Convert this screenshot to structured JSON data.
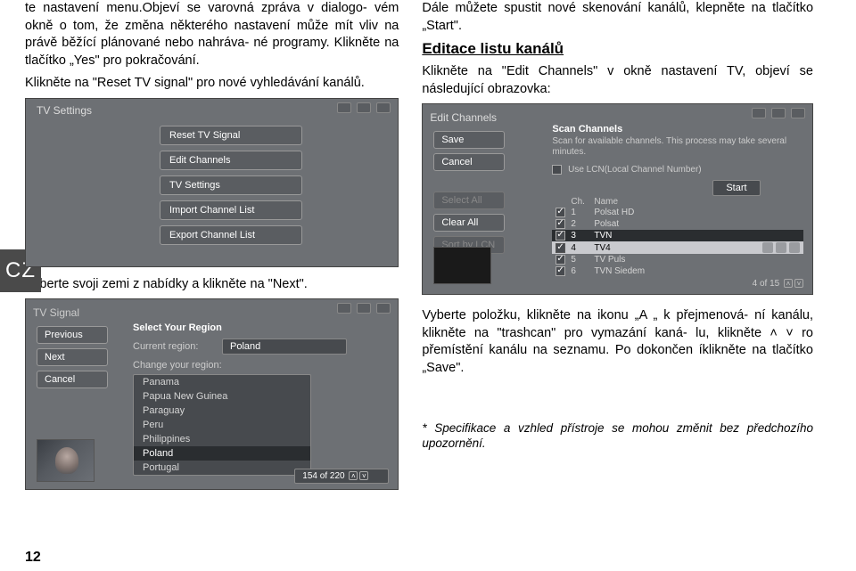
{
  "left": {
    "p1": "te nastavení menu.Objeví se varovná zpráva v dialogo-",
    "p2": "vém okně o tom, že změna některého nastavení může",
    "p3": "mít vliv na právě běžící plánované nebo nahráva-",
    "p4": "né programy. Klikněte na tlačítko „Yes\" pro pokračování.",
    "p5": "Klikněte na \"Reset TV signal\" pro nové vyhledávání kanálů.",
    "caption1": "Vyberte svoji zemi z nabídky a klikněte na  \"Next\".",
    "tvset": {
      "title": "TV Settings",
      "btns": [
        "Reset TV Signal",
        "Edit Channels",
        "TV Settings",
        "Import Channel List",
        "Export Channel List"
      ]
    },
    "tvsig": {
      "title": "TV Signal",
      "leftbtns": [
        "Previous",
        "Next",
        "Cancel"
      ],
      "regionLabel": "Select Your Region",
      "currentRegion": "Current region:",
      "currentVal": "Poland",
      "changeRegion": "Change your region:",
      "countries": [
        "Panama",
        "Papua New Guinea",
        "Paraguay",
        "Peru",
        "Philippines",
        "Poland",
        "Portugal"
      ],
      "counter": "154 of 220"
    }
  },
  "right": {
    "p1": "Dále můžete spustit nové skenování kanálů, klepněte",
    "p2": "na tlačítko „Start\".",
    "head": "Editace listu kanálů",
    "p3": "Klikněte na \"Edit Channels\" v okně nastavení TV, objeví",
    "p4": "se následující obrazovka:",
    "edit": {
      "title": "Edit Channels",
      "btns1": [
        "Save",
        "Cancel"
      ],
      "btns2": [
        "Select All",
        "Clear All",
        "Sort by LCN"
      ],
      "scanTitle": "Scan Channels",
      "scanDesc": "Scan for available channels. This process may take several minutes.",
      "lcnLabel": "Use LCN(Local Channel Number)",
      "start": "Start",
      "chHdr": "Ch.",
      "nameHdr": "Name",
      "rows": [
        {
          "n": "1",
          "name": "Polsat HD"
        },
        {
          "n": "2",
          "name": "Polsat"
        },
        {
          "n": "3",
          "name": "TVN"
        },
        {
          "n": "4",
          "name": "TV4"
        },
        {
          "n": "5",
          "name": "TV Puls"
        },
        {
          "n": "6",
          "name": "TVN Siedem"
        }
      ],
      "counter": "4 of 15"
    },
    "p5": "Vyberte položku, klikněte na ikonu „A „ k přejmenová-",
    "p6": "ní kanálu, klikněte na \"trashcan\" pro vymazání kaná-",
    "p7a": "lu, klikněte ",
    "p7arr": "˄ ˅",
    "p7b": " ro přemístění kanálu na seznamu. Po",
    "p8": "dokončen íklikněte na tlačítko „Save\".",
    "note": "* Specifikace a vzhled přístroje se mohou změnit bez předchozího upozornění."
  },
  "cz": "CZ",
  "pageNum": "12"
}
